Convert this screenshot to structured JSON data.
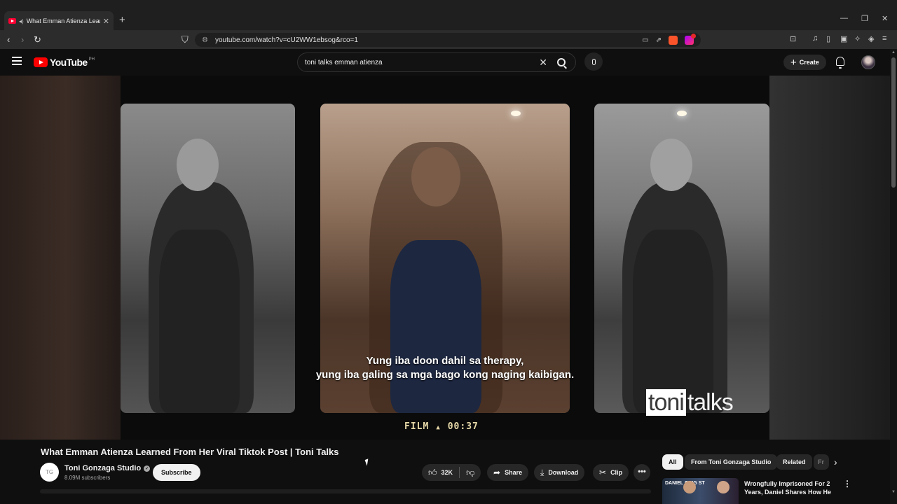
{
  "browser": {
    "tab_title": "What Emman Atienza Learned From Her Viral Tiktok Post",
    "url": "youtube.com/watch?v=cU2WW1ebsog&rco=1"
  },
  "youtube": {
    "logo_text": "YouTube",
    "region": "PH",
    "search_query": "toni talks emman atienza",
    "create_label": "Create"
  },
  "video": {
    "subtitle_line1": "Yung iba doon dahil sa therapy,",
    "subtitle_line2": "yung iba galing sa mga bago kong naging kaibigan.",
    "film_label": "FILM",
    "timecode": "00:37",
    "watermark_part1": "toni",
    "watermark_part2": "talks",
    "title": "What Emman Atienza Learned From Her Viral Tiktok Post | Toni Talks"
  },
  "channel": {
    "name": "Toni Gonzaga Studio",
    "subscribers": "8.09M subscribers",
    "subscribe_label": "Subscribe"
  },
  "actions": {
    "like_count": "32K",
    "share_label": "Share",
    "download_label": "Download",
    "clip_label": "Clip"
  },
  "chips": [
    "All",
    "From Toni Gonzaga Studio",
    "Related",
    "Fr"
  ],
  "recommendation": {
    "thumb_text": "DANIEL ORIG ST",
    "title": "Wrongfully Imprisoned For 2 Years, Daniel Shares How He"
  },
  "icons": {
    "tab_close": "close-icon",
    "back": "back-arrow-icon",
    "forward": "forward-arrow-icon",
    "reload": "reload-icon",
    "bookmark": "bookmark-icon",
    "search": "search-icon",
    "mic": "mic-icon",
    "bell": "bell-icon"
  },
  "colors": {
    "youtube_red": "#ff0000",
    "background": "#0f0f0f",
    "chip_active": "#f1f1f1"
  }
}
